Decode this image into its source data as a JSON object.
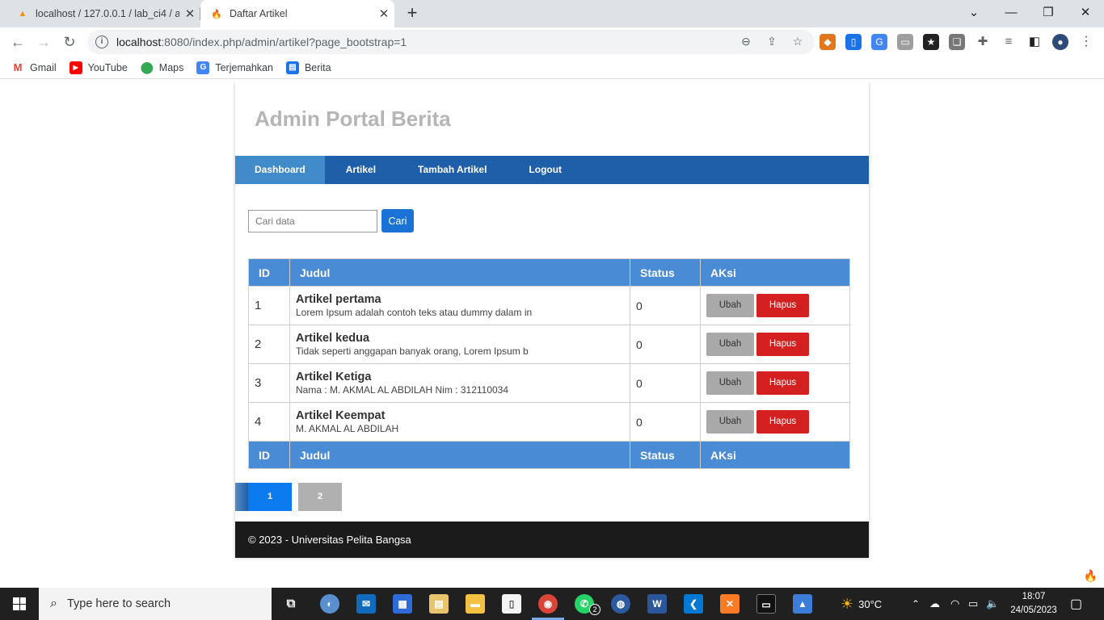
{
  "browser": {
    "tabs": [
      {
        "title": "localhost / 127.0.0.1 / lab_ci4 / ar",
        "favicon": "phpmyadmin-icon",
        "active": false
      },
      {
        "title": "Daftar Artikel",
        "favicon": "flame-icon",
        "active": true
      }
    ],
    "url_host": "localhost",
    "url_rest": ":8080/index.php/admin/artikel?page_bootstrap=1",
    "bookmarks": [
      {
        "label": "Gmail",
        "icon": "gmail-icon"
      },
      {
        "label": "YouTube",
        "icon": "youtube-icon"
      },
      {
        "label": "Maps",
        "icon": "maps-icon"
      },
      {
        "label": "Terjemahkan",
        "icon": "translate-icon"
      },
      {
        "label": "Berita",
        "icon": "news-icon"
      }
    ]
  },
  "page": {
    "site_title": "Admin Portal Berita",
    "nav": [
      {
        "label": "Dashboard",
        "active": true
      },
      {
        "label": "Artikel",
        "active": false
      },
      {
        "label": "Tambah Artikel",
        "active": false
      },
      {
        "label": "Logout",
        "active": false
      }
    ],
    "search": {
      "placeholder": "Cari data",
      "button": "Cari"
    },
    "table": {
      "headers": [
        "ID",
        "Judul",
        "Status",
        "AKsi"
      ],
      "rows": [
        {
          "id": "1",
          "title": "Artikel pertama",
          "excerpt": "Lorem Ipsum adalah contoh teks atau dummy dalam in",
          "status": "0",
          "edit": "Ubah",
          "delete": "Hapus"
        },
        {
          "id": "2",
          "title": "Artikel kedua",
          "excerpt": "Tidak seperti anggapan banyak orang, Lorem Ipsum b",
          "status": "0",
          "edit": "Ubah",
          "delete": "Hapus"
        },
        {
          "id": "3",
          "title": "Artikel Ketiga",
          "excerpt": "Nama : M. AKMAL AL ABDILAH Nim : 312110034",
          "status": "0",
          "edit": "Ubah",
          "delete": "Hapus"
        },
        {
          "id": "4",
          "title": "Artikel Keempat",
          "excerpt": "M. AKMAL AL ABDILAH",
          "status": "0",
          "edit": "Ubah",
          "delete": "Hapus"
        }
      ]
    },
    "pagination": [
      "1",
      "2"
    ],
    "pagination_active": "1",
    "footer": "© 2023 - Universitas Pelita Bangsa"
  },
  "taskbar": {
    "search_placeholder": "Type here to search",
    "weather": "30°C",
    "time": "18:07",
    "date": "24/05/2023",
    "whatsapp_badge": "2"
  },
  "colors": {
    "nav_bar": "#1f5faa",
    "nav_active": "#428bca",
    "table_header": "#4a8bd6",
    "delete_button": "#d42020",
    "edit_button": "#a9a9a9",
    "page_active": "#0d7bf0",
    "footer": "#1b1b1b"
  }
}
